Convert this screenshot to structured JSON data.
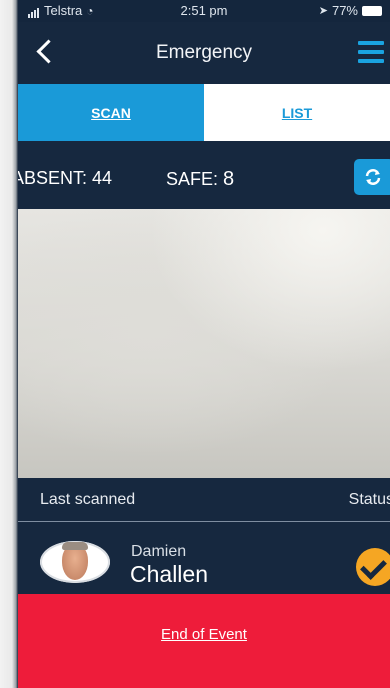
{
  "statusbar": {
    "carrier": "Telstra",
    "time": "2:51 pm",
    "battery": "77%"
  },
  "navbar": {
    "title": "Emergency"
  },
  "tabs": [
    {
      "label": "SCAN",
      "active": true
    },
    {
      "label": "LIST",
      "active": false
    }
  ],
  "counts": {
    "absent_label": "ABSENT:",
    "absent_value": "44",
    "safe_label": "SAFE:",
    "safe_value": "8"
  },
  "scan": {
    "last_scanned_label": "Last scanned",
    "status_label": "Status"
  },
  "person": {
    "first_name": "Damien",
    "last_name": "Challen",
    "status": "safe"
  },
  "footer": {
    "end_label": "End of Event"
  },
  "colors": {
    "navy": "#16283f",
    "accent_blue": "#1a9ad8",
    "end_red": "#ee1c3a",
    "status_orange": "#f5a623"
  },
  "icons": [
    "back-chevron-icon",
    "hamburger-menu-icon",
    "refresh-icon",
    "checkmark-icon",
    "wifi-icon",
    "location-arrow-icon",
    "battery-icon"
  ]
}
